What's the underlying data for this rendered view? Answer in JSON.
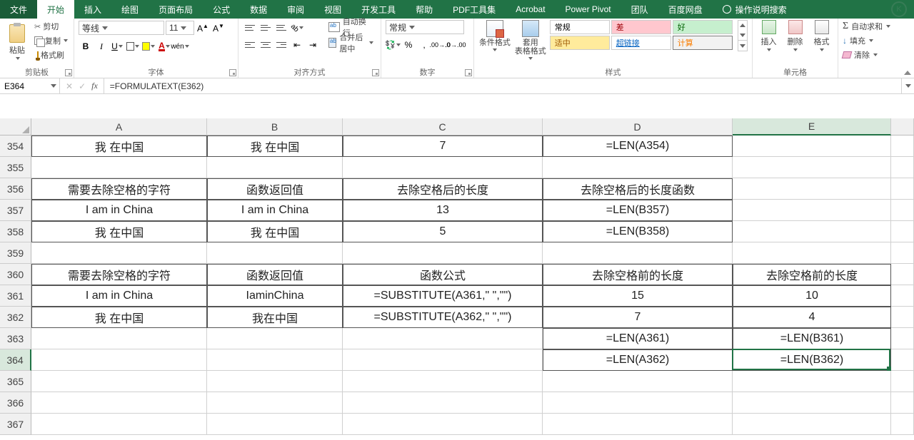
{
  "tabs": {
    "file": "文件",
    "home": "开始",
    "insert": "插入",
    "draw": "绘图",
    "layout": "页面布局",
    "formulas": "公式",
    "data": "数据",
    "review": "审阅",
    "view": "视图",
    "developer": "开发工具",
    "help": "帮助",
    "pdf": "PDF工具集",
    "acrobat": "Acrobat",
    "powerpivot": "Power Pivot",
    "team": "团队",
    "baidu": "百度网盘",
    "tell": "操作说明搜索"
  },
  "ribbon": {
    "clipboard": {
      "paste": "粘贴",
      "cut": "剪切",
      "copy": "复制",
      "painter": "格式刷",
      "label": "剪贴板"
    },
    "font": {
      "name": "等线",
      "size": "11",
      "label": "字体"
    },
    "align": {
      "wrap": "自动换行",
      "merge": "合并后居中",
      "label": "对齐方式"
    },
    "number": {
      "format": "常规",
      "label": "数字"
    },
    "styles": {
      "cf": "条件格式",
      "table": "套用\n表格格式",
      "normal": "常规",
      "bad": "差",
      "good": "好",
      "neutral": "适中",
      "link": "超链接",
      "calc": "计算",
      "label": "样式"
    },
    "cells": {
      "insert": "插入",
      "delete": "删除",
      "format": "格式",
      "label": "单元格"
    },
    "editing": {
      "sum": "自动求和",
      "fill": "填充",
      "clear": "清除"
    }
  },
  "fbar": {
    "name": "E364",
    "formula": "=FORMULATEXT(E362)"
  },
  "cols": [
    "A",
    "B",
    "C",
    "D",
    "E"
  ],
  "rows": [
    "354",
    "355",
    "356",
    "357",
    "358",
    "359",
    "360",
    "361",
    "362",
    "363",
    "364",
    "365",
    "366",
    "367"
  ],
  "selected": {
    "col": 4,
    "row": 10
  },
  "data": {
    "354": {
      "A": "我 在中国",
      "B": "我 在中国",
      "C": "7",
      "D": "=LEN(A354)"
    },
    "356": {
      "A": "需要去除空格的字符",
      "B": "函数返回值",
      "C": "去除空格后的长度",
      "D": "去除空格后的长度函数"
    },
    "357": {
      "A": "I am in China",
      "B": "I am in China",
      "C": "13",
      "D": "=LEN(B357)"
    },
    "358": {
      "A": "我 在中国",
      "B": "我 在中国",
      "C": "5",
      "D": "=LEN(B358)"
    },
    "360": {
      "A": "需要去除空格的字符",
      "B": "函数返回值",
      "C": "函数公式",
      "D": "去除空格前的长度",
      "E": "去除空格前的长度"
    },
    "361": {
      "A": "I am in China",
      "B": "IaminChina",
      "C": "=SUBSTITUTE(A361,\" \",\"\")",
      "D": "15",
      "E": "10"
    },
    "362": {
      "A": "我 在中国",
      "B": "我在中国",
      "C": "=SUBSTITUTE(A362,\" \",\"\")",
      "D": "7",
      "E": "4"
    },
    "363": {
      "D": "=LEN(A361)",
      "E": "=LEN(B361)"
    },
    "364": {
      "D": "=LEN(A362)",
      "E": "=LEN(B362)"
    }
  },
  "borders": {
    "354": [
      "A",
      "B",
      "C",
      "D"
    ],
    "356": [
      "A",
      "B",
      "C",
      "D"
    ],
    "357": [
      "A",
      "B",
      "C",
      "D"
    ],
    "358": [
      "A",
      "B",
      "C",
      "D"
    ],
    "360": [
      "A",
      "B",
      "C",
      "D",
      "E"
    ],
    "361": [
      "A",
      "B",
      "C",
      "D",
      "E"
    ],
    "362": [
      "A",
      "B",
      "C",
      "D",
      "E"
    ],
    "363": [
      "D",
      "E"
    ],
    "364": [
      "D",
      "E"
    ]
  }
}
